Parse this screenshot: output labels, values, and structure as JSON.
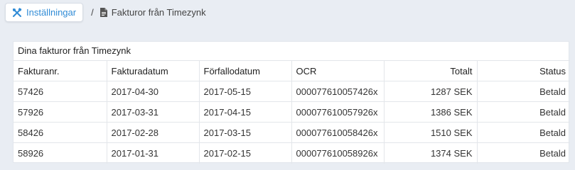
{
  "breadcrumb": {
    "settings_label": "Inställningar",
    "separator": "/",
    "current_label": "Fakturor från Timezynk",
    "settings_icon": "tools-icon",
    "current_icon": "document-icon"
  },
  "panel": {
    "title": "Dina fakturor från Timezynk"
  },
  "table": {
    "headers": [
      "Fakturanr.",
      "Fakturadatum",
      "Förfallodatum",
      "OCR",
      "Totalt",
      "Status"
    ],
    "rows": [
      [
        "57426",
        "2017-04-30",
        "2017-05-15",
        "000077610057426x",
        "1287 SEK",
        "Betald"
      ],
      [
        "57926",
        "2017-03-31",
        "2017-04-15",
        "000077610057926x",
        "1386 SEK",
        "Betald"
      ],
      [
        "58426",
        "2017-02-28",
        "2017-03-15",
        "000077610058426x",
        "1510 SEK",
        "Betald"
      ],
      [
        "58926",
        "2017-01-31",
        "2017-02-15",
        "000077610058926x",
        "1374 SEK",
        "Betald"
      ]
    ]
  },
  "colors": {
    "accent": "#2f8bd6",
    "background": "#e9edf3"
  }
}
